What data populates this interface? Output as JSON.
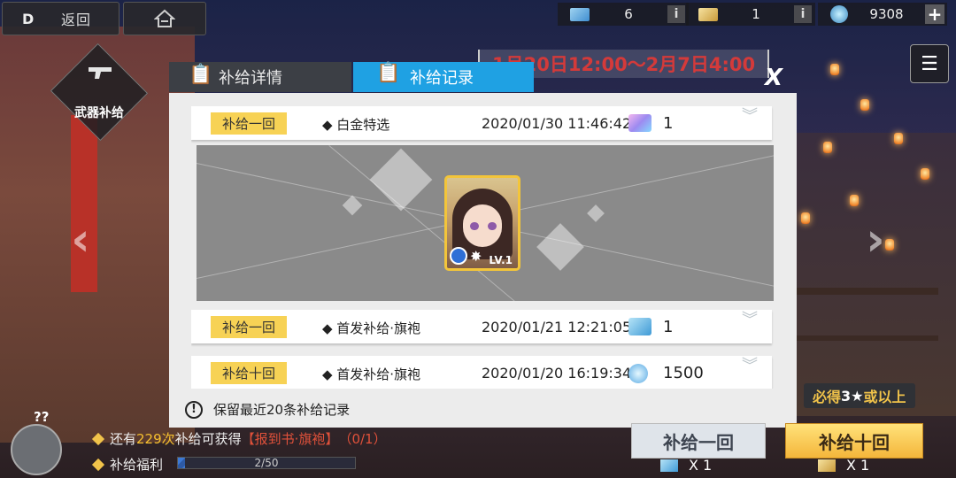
{
  "header": {
    "back_label": "返回",
    "resources": [
      {
        "icon": "blue-ticket-icon",
        "value": "6"
      },
      {
        "icon": "gold-ticket-icon",
        "value": "1"
      },
      {
        "icon": "crystal-icon",
        "value": "9308"
      }
    ]
  },
  "left": {
    "weapon_supply_label": "武器补给"
  },
  "event": {
    "date_range": "1月20日12:00～2月7日4:00"
  },
  "dialog": {
    "tabs": [
      {
        "label": "补给详情",
        "active": false
      },
      {
        "label": "补给记录",
        "active": true
      }
    ],
    "records": [
      {
        "type": "补给一回",
        "pool": "◆ 白金特选",
        "datetime": "2020/01/30 11:46:42",
        "item_icon": "platinum-ticket-icon",
        "qty": "1",
        "expanded": true
      },
      {
        "type": "补给一回",
        "pool": "◆ 首发补给·旗袍",
        "datetime": "2020/01/21 12:21:05",
        "item_icon": "blue-ticket-icon",
        "qty": "1",
        "expanded": false
      },
      {
        "type": "补给十回",
        "pool": "◆ 首发补给·旗袍",
        "datetime": "2020/01/20 16:19:34",
        "item_icon": "crystal-icon",
        "qty": "1500",
        "expanded": false
      }
    ],
    "expanded_reward": {
      "level_label": "LV.1"
    },
    "notice": "保留最近20条补给记录"
  },
  "bottom": {
    "remaining_prefix": "还有",
    "remaining_count": "229次",
    "remaining_suffix": "补给可获得",
    "remaining_item": "【报到书·旗袍】",
    "remaining_progress": "（0/1）",
    "benefit_label": "补给福利",
    "benefit_progress": "2/50",
    "benefit_fraction": 0.04,
    "guarantee_prefix": "必得",
    "guarantee_star": "3★",
    "guarantee_suffix": "或以上",
    "draw_one_label": "补给一回",
    "draw_ten_label": "补给十回",
    "draw_one_cost": "X 1",
    "draw_ten_cost": "X 1"
  },
  "colors": {
    "accent_blue": "#1fa1e3",
    "badge_yellow": "#f7d255",
    "highlight_yellow": "#f6c02f",
    "date_red": "#d43a3a"
  }
}
